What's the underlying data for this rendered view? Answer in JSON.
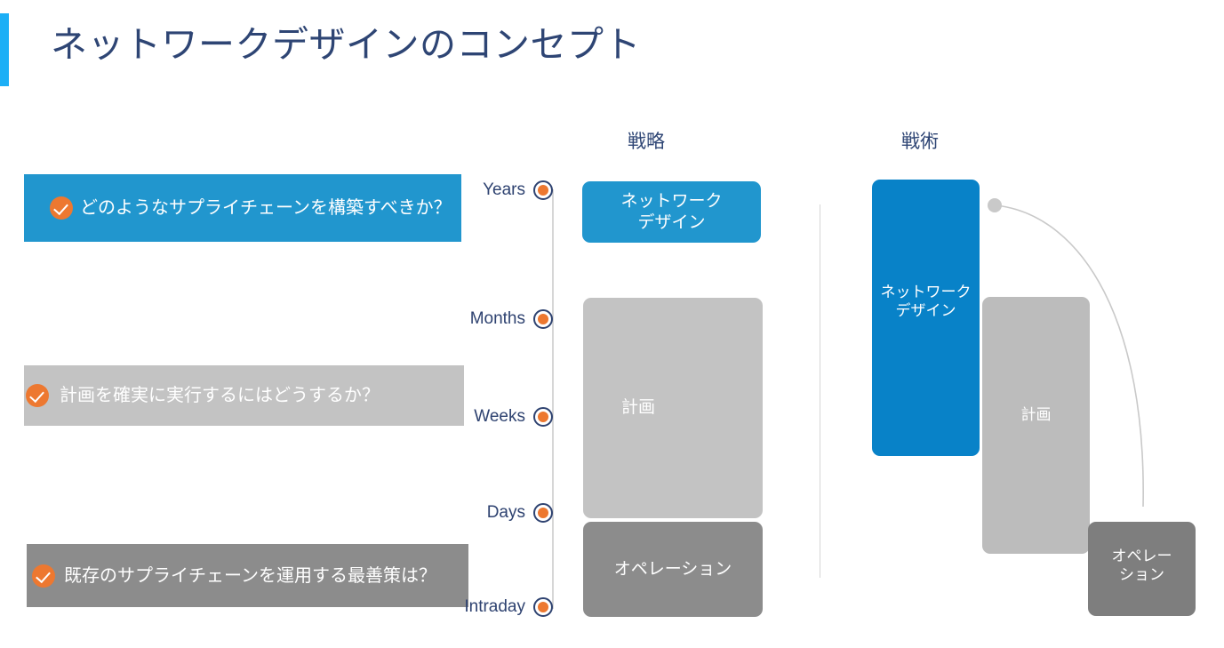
{
  "slide": {
    "title": "ネットワークデザインのコンセプト",
    "accent_color": "#1CAFF6",
    "title_color": "#2e4574"
  },
  "questions": [
    {
      "label": "どのようなサプライチェーンを構築すべきか？",
      "icon": "check-circle-icon",
      "background": "#2196CE",
      "icon_color": "#ED7830"
    },
    {
      "label": "計画を確実に実行するにはどうするか？",
      "icon": "check-circle-icon",
      "background": "#C3C3C3",
      "icon_color": "#ED7830"
    },
    {
      "label": "既存のサプライチェーンを運用する最善策は？",
      "icon": "check-circle-icon",
      "background": "#8C8C8C",
      "icon_color": "#ED7830"
    }
  ],
  "timeline": {
    "dot_fill": "#ED7830",
    "dot_ring": "#2e4270",
    "ticks": [
      {
        "label": "Years"
      },
      {
        "label": "Months"
      },
      {
        "label": "Weeks"
      },
      {
        "label": "Days"
      },
      {
        "label": "Intraday"
      }
    ]
  },
  "columns": {
    "strategy": {
      "header": "戦略",
      "boxes": [
        {
          "label": "ネットワーク\nデザイン",
          "background": "#2196CE"
        },
        {
          "label": "計画",
          "background": "#C3C3C3"
        },
        {
          "label": "オペレーション",
          "background": "#8C8C8C"
        }
      ]
    },
    "tactics": {
      "header": "戦術",
      "boxes": [
        {
          "label": "ネットワーク\nデザイン",
          "background": "#0882C8"
        },
        {
          "label": "計画",
          "background": "#BCBCBC"
        },
        {
          "label": "オペレー\nション",
          "background": "#7E7E7E"
        }
      ]
    }
  }
}
